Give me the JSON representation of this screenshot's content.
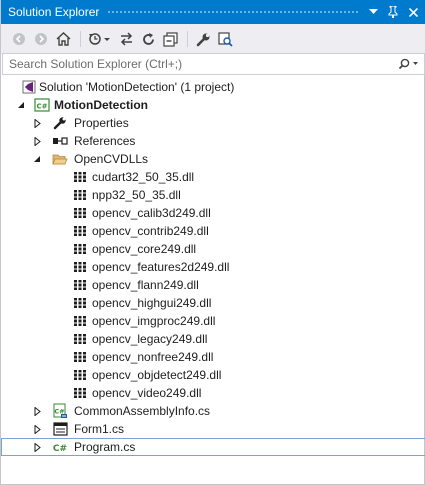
{
  "window": {
    "title": "Solution Explorer"
  },
  "search": {
    "placeholder": "Search Solution Explorer (Ctrl+;)"
  },
  "icons": {
    "back": "back-arrow-icon",
    "forward": "forward-arrow-icon",
    "home": "home-icon",
    "history": "pending-changes-icon",
    "sync": "sync-with-active-document-icon",
    "refresh": "refresh-icon",
    "collapse": "collapse-all-icon",
    "properties": "wrench-icon",
    "preview": "preview-icon"
  },
  "colors": {
    "title_bar": "#007acc",
    "toolbar": "#eeeef2",
    "selection_border": "#7da2ce",
    "csharp_green": "#388a34"
  },
  "tree": {
    "solution": "Solution 'MotionDetection' (1 project)",
    "project": "MotionDetection",
    "properties": "Properties",
    "references": "References",
    "folder": "OpenCVDLLs",
    "dlls": [
      "cudart32_50_35.dll",
      "npp32_50_35.dll",
      "opencv_calib3d249.dll",
      "opencv_contrib249.dll",
      "opencv_core249.dll",
      "opencv_features2d249.dll",
      "opencv_flann249.dll",
      "opencv_highgui249.dll",
      "opencv_imgproc249.dll",
      "opencv_legacy249.dll",
      "opencv_nonfree249.dll",
      "opencv_objdetect249.dll",
      "opencv_video249.dll"
    ],
    "files": [
      "CommonAssemblyInfo.cs",
      "Form1.cs",
      "Program.cs"
    ]
  }
}
